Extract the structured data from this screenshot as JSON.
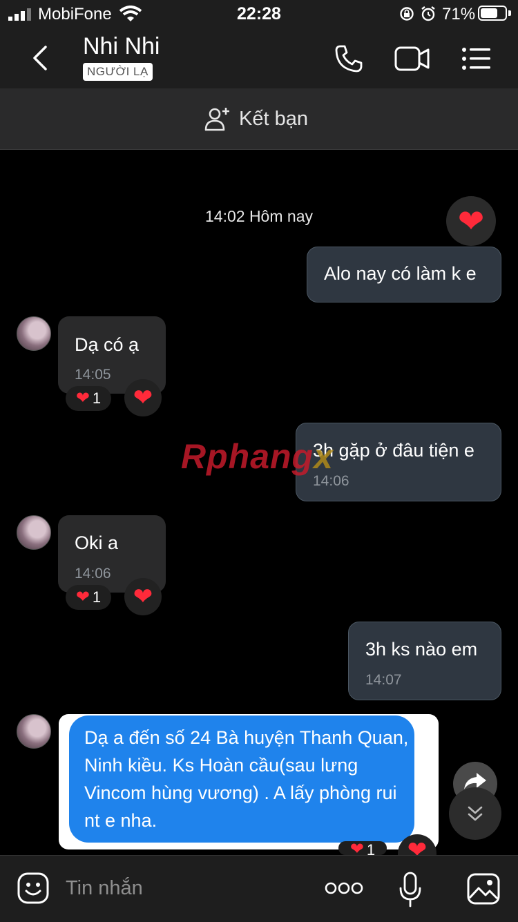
{
  "status_bar": {
    "carrier": "MobiFone",
    "time": "22:28",
    "battery_percent": "71%",
    "battery_level": 0.71,
    "icons": [
      "signal-icon",
      "wifi-icon",
      "rotation-lock-icon",
      "alarm-icon",
      "battery-icon"
    ]
  },
  "header": {
    "contact_name": "Nhi Nhi",
    "badge": "NGƯỜI LẠ",
    "icons": [
      "back-icon",
      "phone-icon",
      "video-call-icon",
      "menu-icon"
    ]
  },
  "add_friend": {
    "label": "Kết bạn"
  },
  "chat": {
    "date_separator": "14:02 Hôm nay",
    "messages": [
      {
        "direction": "out",
        "text": "Alo nay có làm k e"
      },
      {
        "direction": "in",
        "text": "Dạ có ạ",
        "time": "14:05",
        "reaction_count": "1"
      },
      {
        "direction": "out",
        "text": "3h gặp ở đâu tiện e",
        "time": "14:06"
      },
      {
        "direction": "in",
        "text": "Oki a",
        "time": "14:06",
        "reaction_count": "1"
      },
      {
        "direction": "out",
        "text": "3h ks nào em",
        "time": "14:07"
      },
      {
        "direction": "in",
        "type": "image",
        "text": "Dạ a đến số 24 Bà huyện Thanh Quan, Ninh kiều. Ks Hoàn cầu(sau lưng Vincom hùng vương) . A lấy phòng rui nt e nha.",
        "reaction_count": "1"
      }
    ]
  },
  "watermark": {
    "part1": "Rphang",
    "part2": "x"
  },
  "input_bar": {
    "placeholder": "Tin nhắn",
    "icons": [
      "emoji-icon",
      "more-icon",
      "microphone-icon",
      "image-icon"
    ]
  },
  "colors": {
    "outgoing_bubble": "#2f3741",
    "incoming_bubble": "#2a2a2b",
    "heart": "#ff2a3a",
    "image_bubble": "#1f83ec"
  }
}
